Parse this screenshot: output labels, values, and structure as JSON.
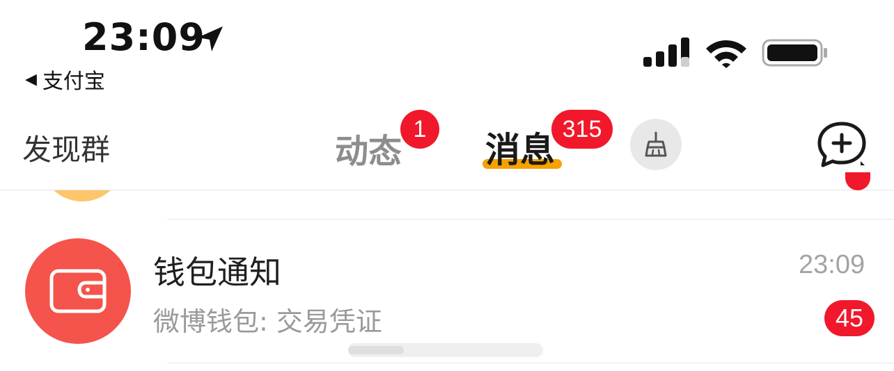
{
  "status_bar": {
    "time": "23:09",
    "back_app": "支付宝",
    "back_glyph": "◀",
    "icons": [
      "location-arrow-icon",
      "signal-icon",
      "wifi-icon",
      "battery-icon"
    ]
  },
  "nav": {
    "discover_label": "发现群",
    "tabs": [
      {
        "label": "动态",
        "badge": "1",
        "active": false
      },
      {
        "label": "消息",
        "badge": "315",
        "active": true
      }
    ],
    "icons": [
      "broom-icon",
      "compose-plus-icon"
    ],
    "accent": "#f6a100",
    "badge_color": "#f1182b"
  },
  "messages": [
    {
      "title": "钱包通知",
      "subtitle": "微博钱包: 交易凭证",
      "time": "23:09",
      "badge": "45",
      "avatar_color": "#f4544b",
      "icon": "wallet-icon"
    }
  ]
}
